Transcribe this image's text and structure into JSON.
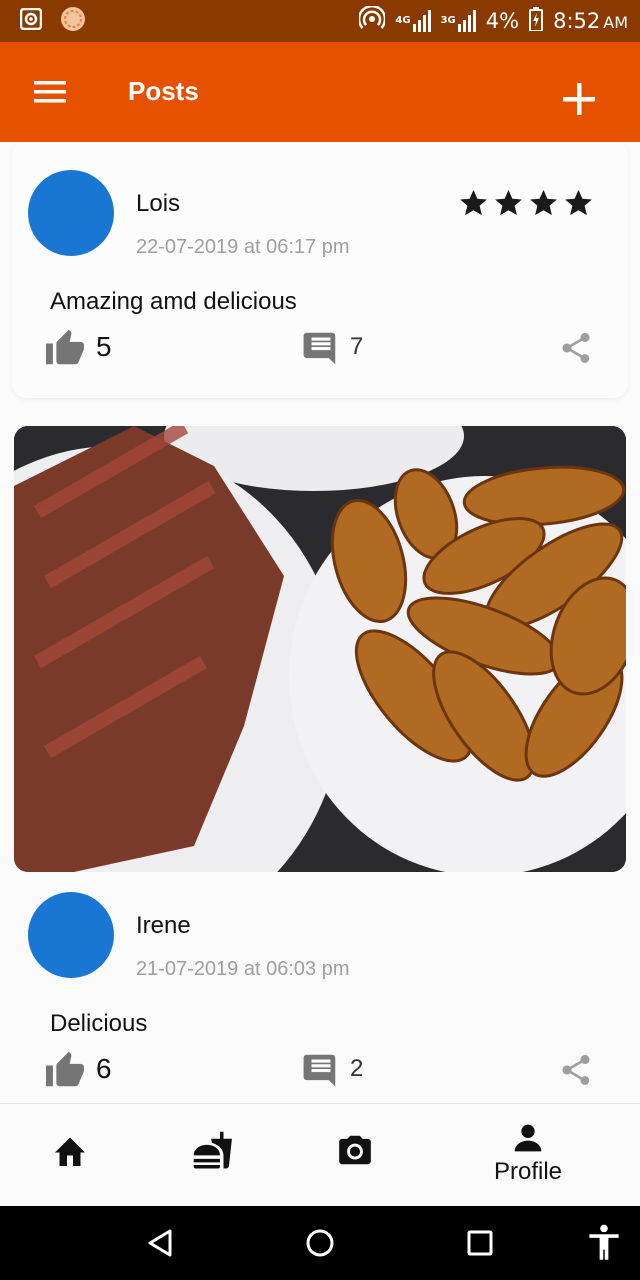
{
  "status_bar": {
    "net_4g": "4G",
    "net_3g": "3G",
    "battery": "4%",
    "time": "8:52",
    "ampm": "AM"
  },
  "app_bar": {
    "title": "Posts",
    "menu_icon": "hamburger-icon",
    "add_icon": "plus-icon"
  },
  "posts": [
    {
      "author": "Lois",
      "timestamp": "22-07-2019 at 06:17 pm",
      "text": "Amazing amd delicious",
      "rating": 4,
      "likes": "5",
      "comments": "7",
      "avatar_color": "#1976d2"
    },
    {
      "author": "Irene",
      "timestamp": "21-07-2019 at 06:03 pm",
      "text": "Delicious",
      "likes": "6",
      "comments": "2",
      "avatar_color": "#1976d2"
    }
  ],
  "bottom_nav": {
    "items": [
      {
        "icon": "home-icon"
      },
      {
        "icon": "fastfood-icon"
      },
      {
        "icon": "camera-icon"
      },
      {
        "icon": "person-icon",
        "label": "Profile"
      }
    ]
  },
  "colors": {
    "status_bar": "#8a3a00",
    "app_bar": "#e65100",
    "avatar": "#1976d2"
  }
}
